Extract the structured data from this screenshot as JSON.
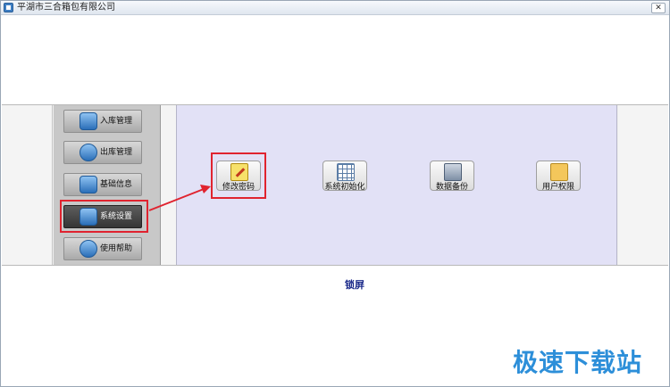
{
  "window": {
    "title": "平湖市三合箱包有限公司",
    "close_glyph": "✕"
  },
  "nav": {
    "items": [
      {
        "label": "入库管理",
        "icon": "warehouse-in-icon"
      },
      {
        "label": "出库管理",
        "icon": "warehouse-out-icon"
      },
      {
        "label": "基础信息",
        "icon": "mail-icon"
      },
      {
        "label": "系统设置",
        "icon": "wrench-icon",
        "active": true
      },
      {
        "label": "使用帮助",
        "icon": "help-icon"
      }
    ]
  },
  "functions": [
    {
      "label": "修改密码",
      "icon": "edit-icon"
    },
    {
      "label": "系统初始化",
      "icon": "calendar-grid-icon"
    },
    {
      "label": "数据备份",
      "icon": "backup-icon"
    },
    {
      "label": "用户权限",
      "icon": "user-permission-icon"
    }
  ],
  "lock_screen_label": "锁屏",
  "watermark": "极速下载站",
  "colors": {
    "highlight": "#e0232f",
    "accent_text": "#1b2a8a",
    "main_panel_bg": "#e2e1f6",
    "watermark": "#2d8fd9"
  }
}
